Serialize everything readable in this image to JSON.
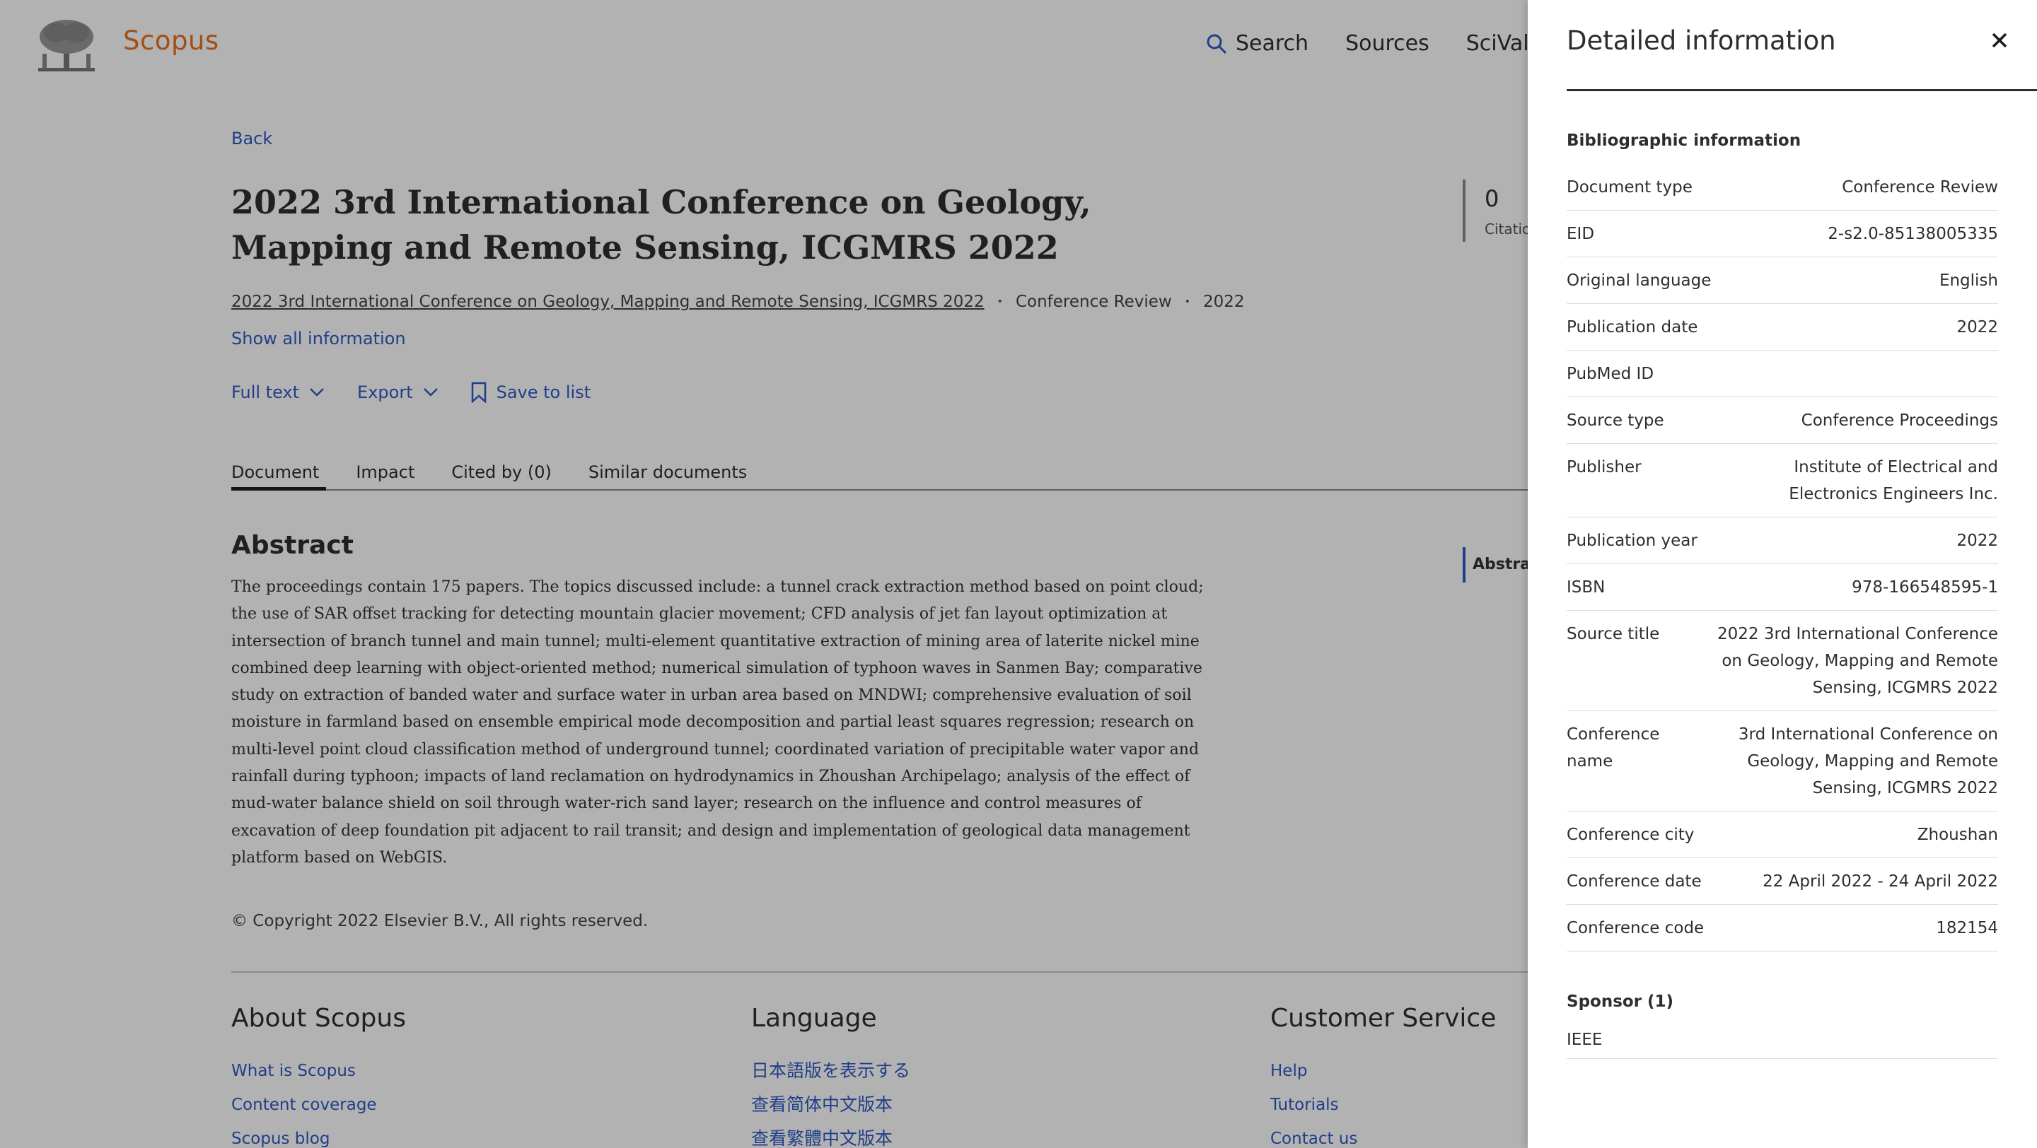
{
  "header": {
    "brand": "Scopus",
    "nav": [
      {
        "label": "Search",
        "icon": "search-icon"
      },
      {
        "label": "Sources"
      },
      {
        "label": "SciVal",
        "icon": "external-arrow-icon"
      }
    ]
  },
  "document": {
    "back_label": "Back",
    "title": "2022 3rd International Conference on Geology, Mapping and Remote Sensing, ICGMRS 2022",
    "source_link": "2022 3rd International Conference on Geology, Mapping and Remote Sensing, ICGMRS 2022",
    "doc_type": "Conference Review",
    "year": "2022",
    "show_all": "Show all information",
    "actions": [
      {
        "label": "Full text"
      },
      {
        "label": "Export"
      },
      {
        "label": "Save to list"
      }
    ],
    "metrics": {
      "value": "0",
      "label": "Citatio"
    },
    "tabs": [
      "Document",
      "Impact",
      "Cited by (0)",
      "Similar documents"
    ],
    "abstract_heading": "Abstract",
    "abstract_text": "The proceedings contain 175 papers. The topics discussed include: a tunnel crack extraction method based on point cloud; the use of SAR offset tracking for detecting mountain glacier movement; CFD analysis of jet fan layout optimization at intersection of branch tunnel and main tunnel; multi-element quantitative extraction of mining area of laterite nickel mine combined deep learning with object-oriented method; numerical simulation of typhoon waves in Sanmen Bay; comparative study on extraction of banded water and surface water in urban area based on MNDWI; comprehensive evaluation of soil moisture in farmland based on ensemble empirical mode decomposition and partial least squares regression; research on multi-level point cloud classification method of underground tunnel; coordinated variation of precipitable water vapor and rainfall during typhoon; impacts of land reclamation on hydrodynamics in Zhoushan Archipelago; analysis of the effect of mud-water balance shield on soil through water-rich sand layer; research on the influence and control measures of excavation of deep foundation pit adjacent to rail transit; and design and implementation of geological data management platform based on WebGIS.",
    "toc_label": "Abstrac",
    "copyright": "© Copyright 2022 Elsevier B.V., All rights reserved."
  },
  "footer": {
    "about": {
      "heading": "About Scopus",
      "links": [
        "What is Scopus",
        "Content coverage",
        "Scopus blog"
      ]
    },
    "language": {
      "heading": "Language",
      "links": [
        "日本語版を表示する",
        "查看简体中文版本",
        "查看繁體中文版本"
      ]
    },
    "service": {
      "heading": "Customer Service",
      "links": [
        "Help",
        "Tutorials",
        "Contact us"
      ]
    }
  },
  "panel": {
    "title": "Detailed information",
    "bib_heading": "Bibliographic information",
    "rows": [
      {
        "label": "Document type",
        "value": "Conference Review"
      },
      {
        "label": "EID",
        "value": "2-s2.0-85138005335"
      },
      {
        "label": "Original language",
        "value": "English"
      },
      {
        "label": "Publication date",
        "value": "2022"
      },
      {
        "label": "PubMed ID",
        "value": ""
      },
      {
        "label": "Source type",
        "value": "Conference Proceedings"
      },
      {
        "label": "Publisher",
        "value": "Institute of Electrical and Electronics Engineers Inc."
      },
      {
        "label": "Publication year",
        "value": "2022"
      },
      {
        "label": "ISBN",
        "value": "978-166548595-1"
      },
      {
        "label": "Source title",
        "value": "2022 3rd International Conference on Geology, Mapping and Remote Sensing, ICGMRS 2022"
      },
      {
        "label": "Conference name",
        "value": "3rd International Conference on Geology, Mapping and Remote Sensing, ICGMRS 2022"
      },
      {
        "label": "Conference city",
        "value": "Zhoushan"
      },
      {
        "label": "Conference date",
        "value": "22 April 2022 - 24 April 2022"
      },
      {
        "label": "Conference code",
        "value": "182154"
      }
    ],
    "sponsor_heading": "Sponsor (1)",
    "sponsors": [
      "IEEE"
    ]
  },
  "colors": {
    "brand": "#e9711c",
    "link": "#2e59c4",
    "overlay": "rgba(0,0,0,0.30)"
  }
}
